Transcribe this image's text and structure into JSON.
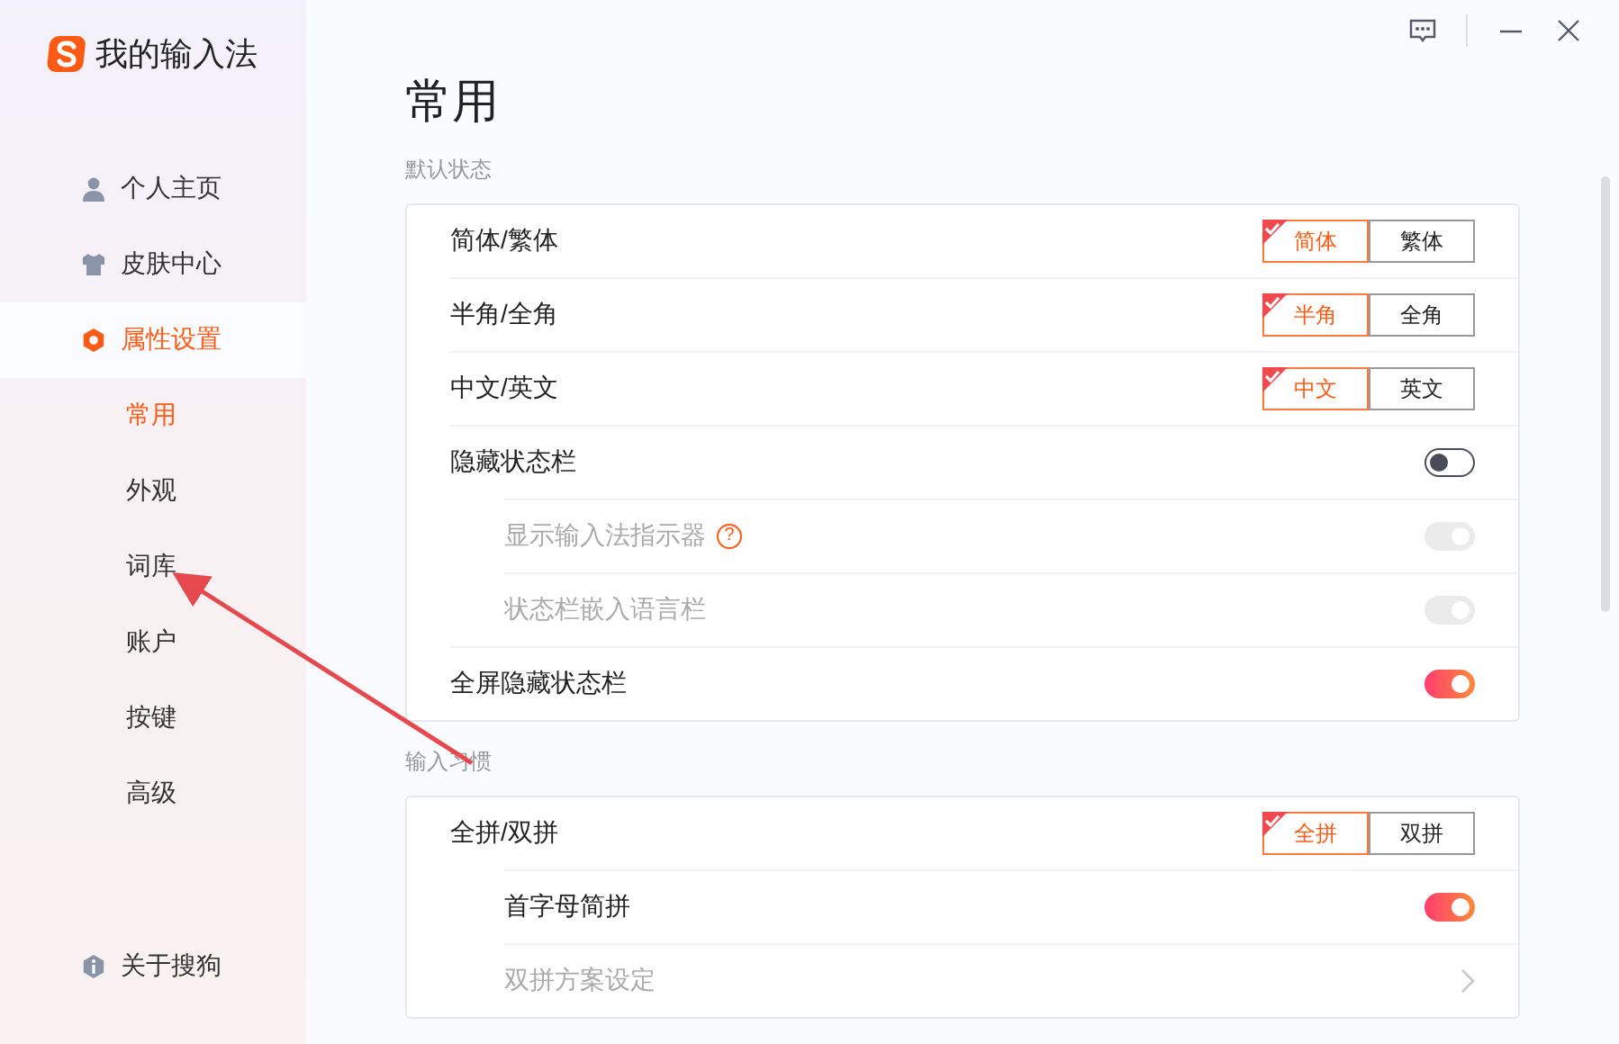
{
  "app": {
    "title": "我的输入法"
  },
  "nav": [
    {
      "label": "个人主页",
      "selected": false
    },
    {
      "label": "皮肤中心",
      "selected": false
    },
    {
      "label": "属性设置",
      "selected": true,
      "children": [
        {
          "label": "常用",
          "selected": true
        },
        {
          "label": "外观",
          "selected": false
        },
        {
          "label": "词库",
          "selected": false
        },
        {
          "label": "账户",
          "selected": false
        },
        {
          "label": "按键",
          "selected": false
        },
        {
          "label": "高级",
          "selected": false
        }
      ]
    }
  ],
  "about": {
    "label": "关于搜狗"
  },
  "page": {
    "title": "常用"
  },
  "sections": [
    {
      "label": "默认状态",
      "rows": [
        {
          "kind": "segment",
          "label": "简体/繁体",
          "options": [
            {
              "label": "简体",
              "selected": true
            },
            {
              "label": "繁体",
              "selected": false
            }
          ]
        },
        {
          "kind": "segment",
          "label": "半角/全角",
          "options": [
            {
              "label": "半角",
              "selected": true
            },
            {
              "label": "全角",
              "selected": false
            }
          ]
        },
        {
          "kind": "segment",
          "label": "中文/英文",
          "options": [
            {
              "label": "中文",
              "selected": true
            },
            {
              "label": "英文",
              "selected": false
            }
          ]
        },
        {
          "kind": "toggle",
          "label": "隐藏状态栏",
          "on": false,
          "disabled": false,
          "children": [
            {
              "kind": "toggle",
              "label": "显示输入法指示器",
              "help": "?",
              "on": true,
              "disabled": true
            },
            {
              "kind": "toggle",
              "label": "状态栏嵌入语言栏",
              "on": true,
              "disabled": true
            }
          ]
        },
        {
          "kind": "toggle",
          "label": "全屏隐藏状态栏",
          "on": true,
          "disabled": false
        }
      ]
    },
    {
      "label": "输入习惯",
      "rows": [
        {
          "kind": "segment",
          "label": "全拼/双拼",
          "options": [
            {
              "label": "全拼",
              "selected": true
            },
            {
              "label": "双拼",
              "selected": false
            }
          ],
          "children": [
            {
              "kind": "toggle",
              "label": "首字母简拼",
              "on": true,
              "disabled": false
            },
            {
              "kind": "link",
              "label": "双拼方案设定",
              "disabled": true
            }
          ]
        }
      ]
    }
  ]
}
